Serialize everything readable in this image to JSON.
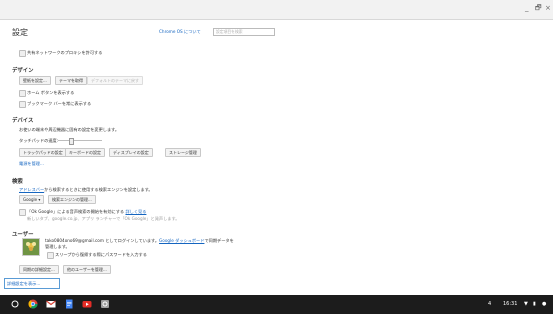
{
  "window": {
    "minimize_glyph": "_",
    "maximize_glyph": "🗗",
    "close_glyph": "×"
  },
  "header": {
    "title": "設定",
    "about_link": "Chrome OS について",
    "search_placeholder": "設定項目を検索"
  },
  "proxy": {
    "checkbox_label": "共有ネットワークのプロキシを許可する"
  },
  "design": {
    "heading": "デザイン",
    "buttons": [
      "壁紙を設定...",
      "テーマを取得",
      "デフォルトのテーマに戻す"
    ],
    "checkboxes": [
      "ホーム ボタンを表示する",
      "ブックマーク バーを常に表示する"
    ]
  },
  "device": {
    "heading": "デバイス",
    "description": "お使いの端末や周辺機器に固有の設定を変更します。",
    "touchpad_speed_label": "タッチパッドの速度:",
    "buttons": [
      "トラックパッドの設定",
      "キーボードの設定",
      "ディスプレイの設定",
      "ストレージ管理"
    ],
    "power_link": "電源を管理..."
  },
  "search": {
    "heading": "検索",
    "desc_link": "アドレスバー",
    "desc_text": "から検索するときに使用する検索エンジンを設定します。",
    "engine_select": "Google",
    "manage_button": "検索エンジンの管理...",
    "ok_google_label": "「Ok Google」による音声検索の開始を有効にする",
    "ok_google_link": "詳しく見る",
    "ok_google_sub": "新しいタブ、google.co.jp、アプリ ランチャーで「Ok Google」と発声します。"
  },
  "users": {
    "heading": "ユーザー",
    "signed_in_text": "tako0804ono69@gmail.com としてログインしています。",
    "dashboard_link": "Google ダッシュボード",
    "signed_in_text2": "で同期データを",
    "signed_in_text3": "管理します。",
    "password_checkbox": "スリープから復帰する際にパスワードを入力する",
    "buttons": [
      "同期の詳細設定...",
      "他のユーザーを管理..."
    ]
  },
  "advanced_link": "詳細設定を表示...",
  "shelf": {
    "apps": [
      "launcher-icon",
      "chrome-icon",
      "gmail-icon",
      "docs-icon",
      "youtube-icon",
      "settings-icon"
    ],
    "status_number": "4",
    "time": "16:31"
  }
}
